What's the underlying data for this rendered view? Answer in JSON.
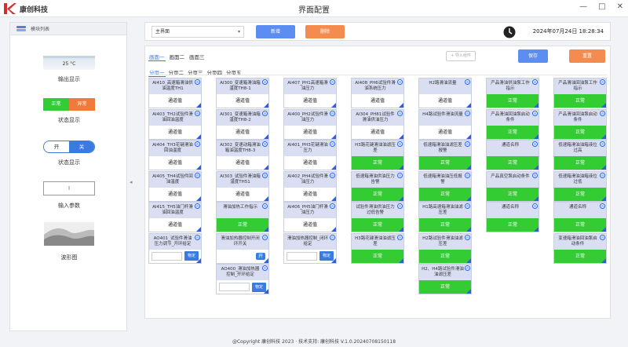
{
  "app": {
    "logo_text": "康创科技",
    "title": "界面配置",
    "controls": [
      "—",
      "□",
      "✕"
    ]
  },
  "sidebar": {
    "header": "模块列表",
    "items": [
      {
        "label": "输出显示",
        "preview": "25 °C"
      },
      {
        "label": "状态显示",
        "preview_on": "正常",
        "preview_off": "异常"
      },
      {
        "label": "状态显示",
        "toggle_on": "开",
        "toggle_off": "关"
      },
      {
        "label": "输入参数",
        "cursor": "I"
      },
      {
        "label": "波形图"
      }
    ]
  },
  "toolbar": {
    "select_value": "主界面",
    "add_label": "新增",
    "delete_label": "删除",
    "datetime": "2024年07月24日  18:28:34"
  },
  "main": {
    "screens": [
      "画面一",
      "画面二",
      "画面三"
    ],
    "active_screen": 0,
    "pages": [
      "分页一",
      "分页二",
      "分页三",
      "分页四",
      "分页五"
    ],
    "active_page": 0,
    "import_label": "+ 导入组件",
    "save_label": "保存",
    "reset_label": "重置"
  },
  "columns": [
    [
      {
        "title": "AI410_高速箱滑油供油温度TH1",
        "value": "通道值",
        "type": "value"
      },
      {
        "title": "AI403_TH2试验件滑油回油温度",
        "value": "通道值",
        "type": "value"
      },
      {
        "title": "AI404_TH3花键滑油回油温度",
        "value": "通道值",
        "type": "value"
      },
      {
        "title": "AI405_TH4试验件回油温度",
        "value": "通道值",
        "type": "value"
      },
      {
        "title": "AI415_TH5油门杆滑油回油温度",
        "value": "通道值",
        "type": "value"
      },
      {
        "title": "AO401_试验件滑油压力调节_开环给定",
        "value": "物定",
        "type": "input"
      }
    ],
    [
      {
        "title": "AI300_变速箱滑油箱温度TH8-1",
        "value": "通道值",
        "type": "value"
      },
      {
        "title": "AI301_变速箱滑油箱温度TH8-2",
        "value": "通道值",
        "type": "value"
      },
      {
        "title": "AI302_变速动箱滑油箱油温度TH8-3",
        "value": "通道值",
        "type": "value"
      },
      {
        "title": "AI303_试验件滑油箱温度TH51",
        "value": "通道值",
        "type": "value"
      },
      {
        "title": "滑油加热工作指示",
        "value": "正常",
        "type": "status"
      },
      {
        "title": "滑油加热器控制开闭环开关",
        "value": "开",
        "type": "toggle"
      },
      {
        "title": "AO400_滑油加热器控制_开环给定",
        "value": "物定",
        "type": "input"
      }
    ],
    [
      {
        "title": "AI407_PH1高速箱滑油压力",
        "value": "通道值",
        "type": "value"
      },
      {
        "title": "AI400_PH2试验件滑油压力",
        "value": "通道值",
        "type": "value"
      },
      {
        "title": "AI401_PH3花键滑油压力",
        "value": "通道值",
        "type": "value"
      },
      {
        "title": "AI402_PH4试验件滑油压力",
        "value": "通道值",
        "type": "value"
      },
      {
        "title": "AI406_PH5油门杆滑油压力",
        "value": "通道值",
        "type": "value"
      },
      {
        "title": "滑油加热器控制_闭环给定",
        "value": "物定",
        "type": "input"
      }
    ],
    [
      {
        "title": "AI408_PH6试验件滑油系统压力",
        "value": "通道值",
        "type": "value"
      },
      {
        "title": "AI304_PH81试验件滑油供油压力",
        "value": "通道值",
        "type": "value"
      },
      {
        "title": "H3路花键滑油油滤压差",
        "value": "正常",
        "type": "status"
      },
      {
        "title": "低速箱滑油供油压力告警",
        "value": "正常",
        "type": "status"
      },
      {
        "title": "试验件滑油供油压力过低告警",
        "value": "正常",
        "type": "status"
      },
      {
        "title": "H3路花键滑油油滤压差",
        "value": "正常",
        "type": "status"
      }
    ],
    [
      {
        "title": "H2路滑油流量",
        "value": "通道值",
        "type": "value"
      },
      {
        "title": "H4路试验件滑油流量",
        "value": "通道值",
        "type": "value"
      },
      {
        "title": "低速箱滑油油滤压差报警",
        "value": "正常",
        "type": "status"
      },
      {
        "title": "低速箱滑油油压低报警",
        "value": "正常",
        "type": "status"
      },
      {
        "title": "H1路高速箱滑油油滤压差",
        "value": "正常",
        "type": "status"
      },
      {
        "title": "H2路试验件滑油油滤压差",
        "value": "正常",
        "type": "status"
      },
      {
        "title": "H2、H4路试验件滑油油滤压差",
        "value": "正常",
        "type": "status"
      }
    ],
    [
      {
        "title": "产品滑油供油泵工作指示",
        "value": "正常",
        "type": "status"
      },
      {
        "title": "产品滑油回油泵启动条件",
        "value": "正常",
        "type": "status"
      },
      {
        "title": "通道名称",
        "value": "正常",
        "type": "status"
      },
      {
        "title": "产品真空泵启动条件",
        "value": "正常",
        "type": "status"
      },
      {
        "title": "通道名称",
        "value": "正常",
        "type": "status"
      }
    ],
    [
      {
        "title": "产品滑油回油泵工作指示",
        "value": "正常",
        "type": "status"
      },
      {
        "title": "产品滑油回油泵启动条件",
        "value": "正常",
        "type": "status"
      },
      {
        "title": "低速箱滑油油箱液位过高",
        "value": "正常",
        "type": "status"
      },
      {
        "title": "低速箱滑油油箱液位过低",
        "value": "正常",
        "type": "status"
      },
      {
        "title": "通道名称",
        "value": "正常",
        "type": "status"
      },
      {
        "title": "变速箱滑油回油泵启动条件",
        "value": "正常",
        "type": "status"
      }
    ]
  ],
  "footer": "@Copyright 康创科技 2023 · 技术支持: 康创科技 V.1.0.20240708150118",
  "colors": {
    "accent": "#3b7be0",
    "green": "#33cc33",
    "orange": "#f07a3c",
    "card_head": "#d9def2"
  }
}
